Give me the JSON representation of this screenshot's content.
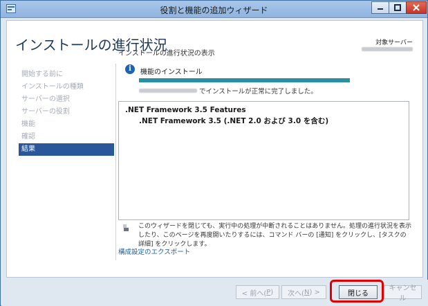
{
  "window": {
    "title": "役割と機能の追加ウィザード",
    "controls": {
      "minimize_icon": "minimize-icon",
      "maximize_icon": "maximize-icon",
      "close_icon": "close-icon"
    }
  },
  "header": {
    "title": "インストールの進行状況",
    "target_server_label": "対象サーバー"
  },
  "nav": {
    "items": [
      {
        "label": "開始する前に",
        "active": false
      },
      {
        "label": "インストールの種類",
        "active": false
      },
      {
        "label": "サーバーの選択",
        "active": false
      },
      {
        "label": "サーバーの役割",
        "active": false
      },
      {
        "label": "機能",
        "active": false
      },
      {
        "label": "確認",
        "active": false
      },
      {
        "label": "結果",
        "active": true
      }
    ]
  },
  "main": {
    "progress_heading": "インストールの進行状況の表示",
    "feature_install_label": "機能のインストール",
    "progress": 1.0,
    "success_text": "でインストールが正常に完了しました。",
    "results": [
      ".NET Framework 3.5 Features",
      ".NET Framework 3.5 (.NET 2.0 および 3.0 を含む)"
    ],
    "notice": "このウィザードを閉じても、実行中の処理が中断されることはありません。処理の進行状況を表示したり、このページを再度開いたりするには、コマンド バーの [通知] をクリックし、[タスクの詳細] をクリックします。",
    "export_link": "構成設定のエクスポート"
  },
  "footer": {
    "prev_label": "< 前へ(",
    "prev_key": "P",
    "prev_tail": ")",
    "next_label": "次へ(",
    "next_key": "N",
    "next_tail": ") >",
    "close_label": "閉じる",
    "cancel_label": "キャンセル"
  },
  "colors": {
    "accent": "#2a579a",
    "progress": "#2a8fa0",
    "highlight": "#e00000",
    "link": "#1e5fa8"
  }
}
